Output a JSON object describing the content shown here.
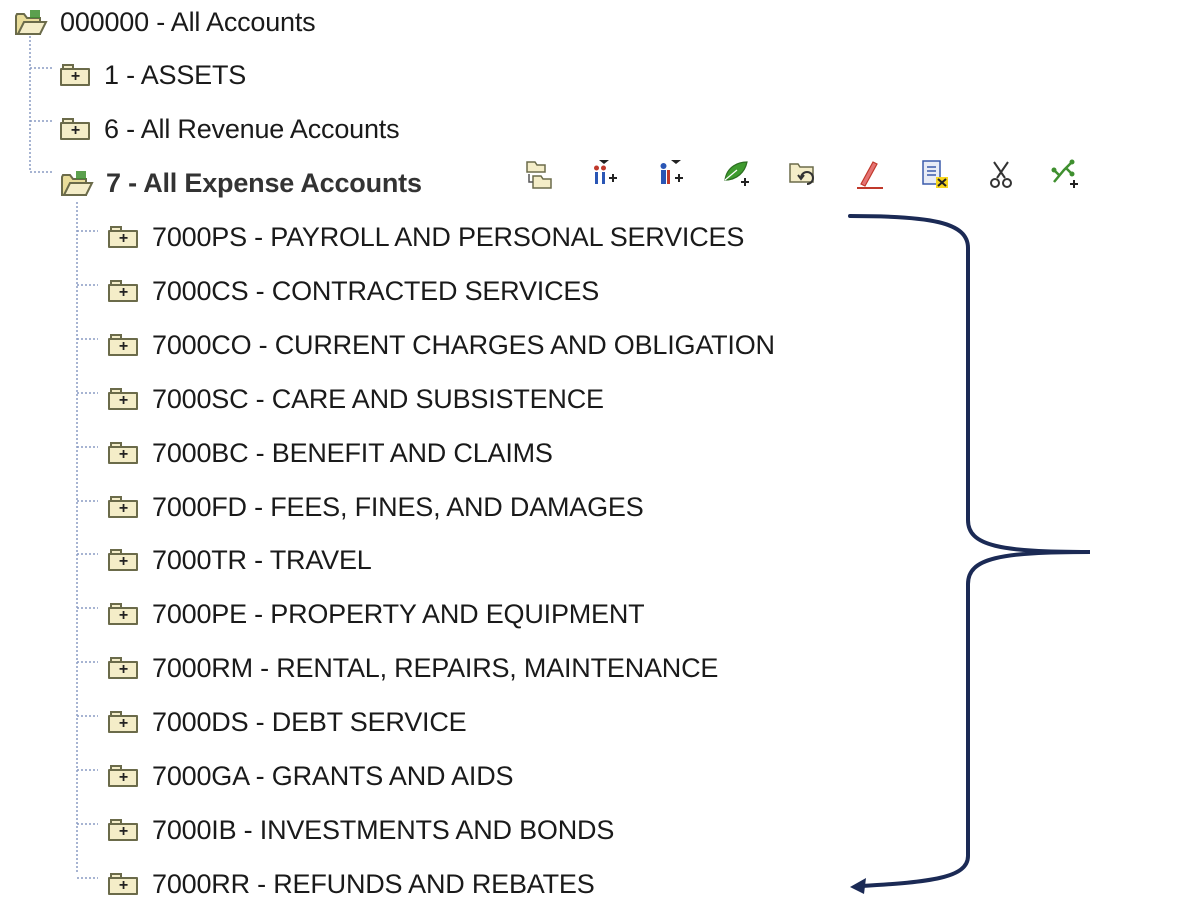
{
  "tree": {
    "root": {
      "label": "000000 - All Accounts",
      "icon": "folder-open-icon"
    },
    "children": [
      {
        "label": "1 - ASSETS",
        "icon": "folder-plus-icon"
      },
      {
        "label": "6 - All Revenue Accounts",
        "icon": "folder-plus-icon"
      },
      {
        "label": "7 - All Expense Accounts",
        "icon": "folder-open-icon",
        "selected": true
      }
    ],
    "expense_children": [
      {
        "label": "7000PS - PAYROLL AND PERSONAL SERVICES"
      },
      {
        "label": "7000CS - CONTRACTED SERVICES"
      },
      {
        "label": "7000CO - CURRENT CHARGES AND OBLIGATION"
      },
      {
        "label": "7000SC - CARE AND SUBSISTENCE"
      },
      {
        "label": "7000BC - BENEFIT AND CLAIMS"
      },
      {
        "label": "7000FD - FEES, FINES, AND DAMAGES"
      },
      {
        "label": "7000TR - TRAVEL"
      },
      {
        "label": "7000PE - PROPERTY AND EQUIPMENT"
      },
      {
        "label": "7000RM - RENTAL, REPAIRS, MAINTENANCE"
      },
      {
        "label": "7000DS - DEBT SERVICE"
      },
      {
        "label": "7000GA - GRANTS AND AIDS"
      },
      {
        "label": "7000IB - INVESTMENTS AND BONDS"
      },
      {
        "label": "7000RR - REFUNDS AND REBATES"
      }
    ]
  },
  "toolbar": {
    "buttons": [
      {
        "icon": "move-folder-icon"
      },
      {
        "icon": "add-child-members-icon"
      },
      {
        "icon": "add-sibling-members-icon"
      },
      {
        "icon": "add-leaf-icon"
      },
      {
        "icon": "restore-folder-icon"
      },
      {
        "icon": "edit-pencil-icon"
      },
      {
        "icon": "delete-document-icon"
      },
      {
        "icon": "cut-scissors-icon"
      },
      {
        "icon": "add-tree-icon"
      }
    ]
  },
  "colors": {
    "annotation_brace": "#1b2a55",
    "tree_connector": "#8a9cc4",
    "folder_outline": "#6b6b4a",
    "folder_fill": "#f4edc8",
    "folder_green": "#3f8f2f"
  }
}
